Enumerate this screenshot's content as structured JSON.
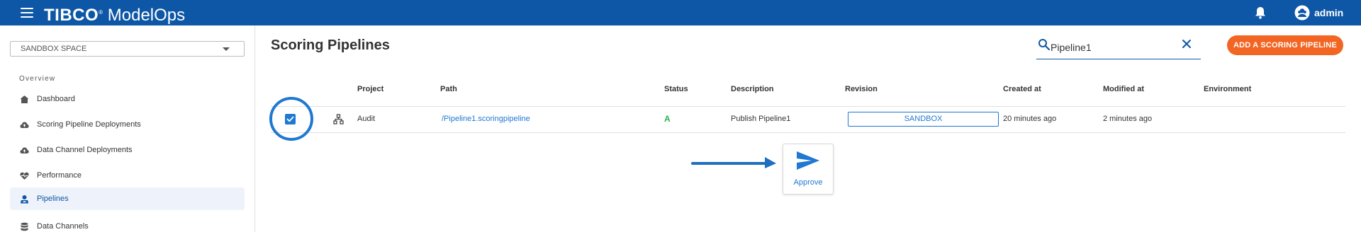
{
  "header": {
    "brand_bold": "TIBC",
    "brand_mark": "O",
    "brand_product": "ModelOps",
    "user_name": "admin"
  },
  "sidebar": {
    "space_select_value": "SANDBOX SPACE",
    "section_title": "Overview",
    "items": [
      {
        "label": "Dashboard",
        "icon": "home-icon",
        "active": false
      },
      {
        "label": "Scoring Pipeline Deployments",
        "icon": "cloud-upload-icon",
        "active": false
      },
      {
        "label": "Data Channel Deployments",
        "icon": "cloud-upload-icon",
        "active": false
      },
      {
        "label": "Performance",
        "icon": "heart-pulse-icon",
        "active": false
      },
      {
        "label": "Pipelines",
        "icon": "pipeline-icon",
        "active": true
      },
      {
        "label": "Data Channels",
        "icon": "database-icon",
        "active": false
      }
    ]
  },
  "main": {
    "title": "Scoring Pipelines",
    "search_value": "Pipeline1",
    "add_button_label": "ADD A SCORING PIPELINE",
    "columns": [
      "Project",
      "Path",
      "Status",
      "Description",
      "Revision",
      "Created at",
      "Modified at",
      "Environment"
    ],
    "rows": [
      {
        "selected": true,
        "project": "Audit",
        "path": "/Pipeline1.scoringpipeline",
        "status": "A",
        "description": "Publish Pipeline1",
        "revision": "SANDBOX",
        "created_at": "20 minutes ago",
        "modified_at": "2 minutes ago",
        "environment": ""
      }
    ],
    "approve_label": "Approve"
  },
  "colors": {
    "topbar": "#0d57a6",
    "accent": "#1f78d1",
    "add_button": "#f26522",
    "status_approved": "#2db34a",
    "active_nav_bg": "#eef2fa"
  }
}
